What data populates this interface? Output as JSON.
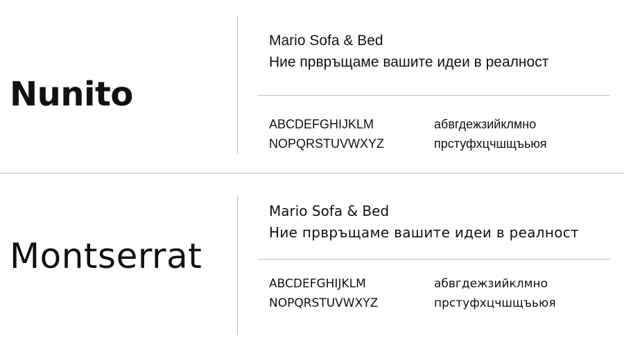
{
  "sections": [
    {
      "font_name": "Nunito",
      "brand": "Mario Sofa & Bed",
      "slogan": "Ние првръщаме вашите идеи в реалност",
      "latin_upper_1": "ABCDEFGHIJKLM",
      "latin_upper_2": "NOPQRSTUVWXYZ",
      "cyrillic_lower_1": "абвгдежзийклмно",
      "cyrillic_lower_2": "прстуфхцчшщъьюя"
    },
    {
      "font_name": "Montserrat",
      "brand": "Mario Sofa & Bed",
      "slogan": "Ние првръщаме вашите идеи в реалност",
      "latin_upper_1": "ABCDEFGHIJKLM",
      "latin_upper_2": "NOPQRSTUVWXYZ",
      "cyrillic_lower_1": "абвгдежзийклмно",
      "cyrillic_lower_2": "прстуфхцчшщъьюя"
    }
  ],
  "colors": {
    "text": "#111111",
    "divider": "#bdbdbd",
    "background": "#ffffff"
  }
}
